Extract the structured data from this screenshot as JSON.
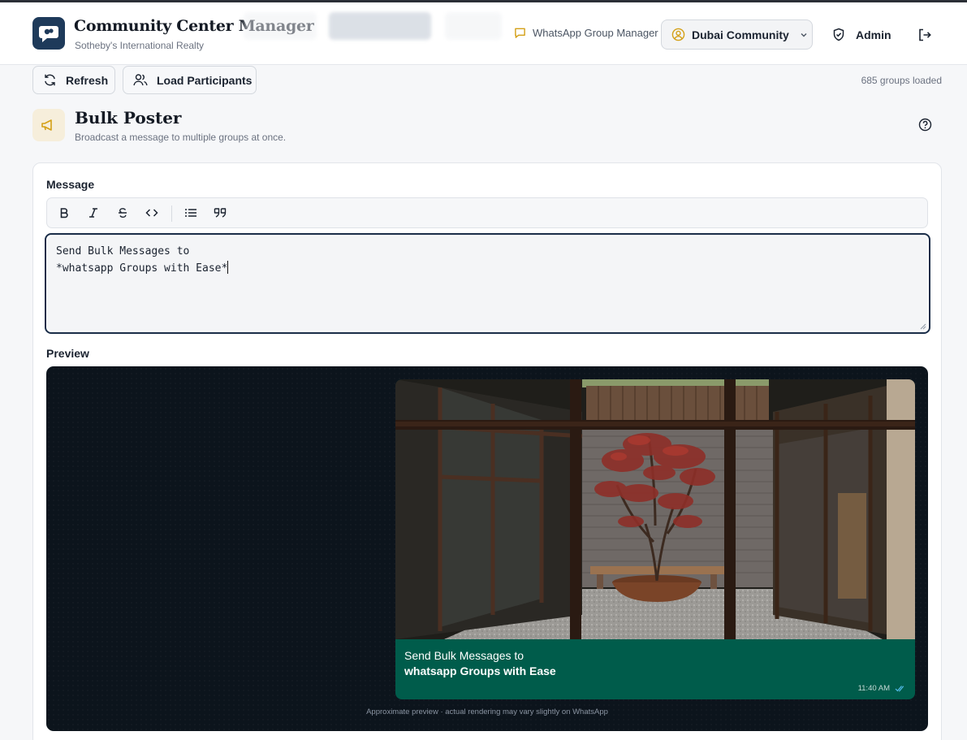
{
  "header": {
    "app_title": "Community Center Manager",
    "app_subtitle": "Sotheby's International Realty",
    "whatsapp_link": "WhatsApp Group Manager",
    "community_selector": "Dubai Community",
    "user_label": "Admin"
  },
  "actions": {
    "refresh_label": "Refresh",
    "load_participants_label": "Load Participants",
    "groups_loaded": "685 groups loaded"
  },
  "bulk_poster": {
    "title": "Bulk Poster",
    "subtitle": "Broadcast a message to multiple groups at once."
  },
  "composer": {
    "message_label": "Message",
    "toolbar": [
      "bold-icon",
      "italic-icon",
      "strikethrough-icon",
      "code-icon",
      "bullet-list-icon",
      "quote-icon"
    ],
    "message_value": "Send Bulk Messages to\n*whatsapp Groups with Ease*"
  },
  "preview": {
    "label": "Preview",
    "line1": "Send Bulk Messages to",
    "line2_bold": "whatsapp Groups with Ease",
    "time": "11:40 AM",
    "note": "Approximate preview · actual rendering may vary slightly on WhatsApp"
  },
  "colors": {
    "brand_navy": "#1e3a5a",
    "accent_gold": "#d4a017",
    "whatsapp_bubble": "#005c4b",
    "preview_bg": "#0c141c"
  }
}
